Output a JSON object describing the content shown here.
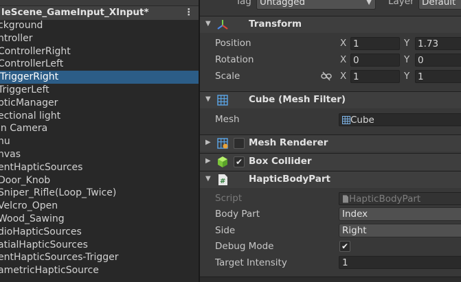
{
  "hierarchy": {
    "scene_name": "leScene_GameInput_XInput*",
    "menu_icon": "kebab-menu-icon",
    "items": [
      {
        "label": "ckground"
      },
      {
        "label": "ntroller"
      },
      {
        "label": "ControllerRight"
      },
      {
        "label": "ControllerLeft"
      },
      {
        "label": "TriggerRight",
        "selected": true
      },
      {
        "label": "TriggerLeft"
      },
      {
        "label": "pticManager"
      },
      {
        "label": "ectional light"
      },
      {
        "label": "in Camera"
      },
      {
        "label": "nu"
      },
      {
        "label": "nvas"
      },
      {
        "label": "entHapticSources"
      },
      {
        "label": "Door_Knob"
      },
      {
        "label": "Sniper_Rifle(Loop_Twice)"
      },
      {
        "label": "Velcro_Open"
      },
      {
        "label": "Wood_Sawing"
      },
      {
        "label": "dioHapticSources"
      },
      {
        "label": "atialHapticSources"
      },
      {
        "label": "entHapticSources-Trigger"
      },
      {
        "label": "ametricHapticSource"
      }
    ]
  },
  "inspector": {
    "tag_label": "Tag",
    "tag_value": "Untagged",
    "layer_label": "Layer",
    "layer_value": "Default",
    "transform": {
      "title": "Transform",
      "icon": "transform-axes-icon",
      "position_label": "Position",
      "rotation_label": "Rotation",
      "scale_label": "Scale",
      "scale_link_icon": "unlinked-chain-icon",
      "axis_x": "X",
      "axis_y": "Y",
      "position": {
        "x": "1",
        "y": "1.73"
      },
      "rotation": {
        "x": "0",
        "y": "0"
      },
      "scale": {
        "x": "1",
        "y": "1"
      }
    },
    "mesh_filter": {
      "title": "Cube (Mesh Filter)",
      "icon": "mesh-grid-icon",
      "mesh_label": "Mesh",
      "mesh_value": "Cube"
    },
    "mesh_renderer": {
      "title": "Mesh Renderer",
      "icon": "mesh-renderer-icon",
      "enabled": false
    },
    "box_collider": {
      "title": "Box Collider",
      "icon": "box-collider-cube-icon",
      "enabled": true
    },
    "haptic_body_part": {
      "title": "HapticBodyPart",
      "icon": "csharp-script-icon",
      "script_label": "Script",
      "script_value": "HapticBodyPart",
      "body_part_label": "Body Part",
      "body_part_value": "Index",
      "side_label": "Side",
      "side_value": "Right",
      "debug_mode_label": "Debug Mode",
      "debug_mode_checked": true,
      "target_intensity_label": "Target Intensity",
      "target_intensity_value": "1"
    },
    "checkmark_glyph": "✔"
  }
}
